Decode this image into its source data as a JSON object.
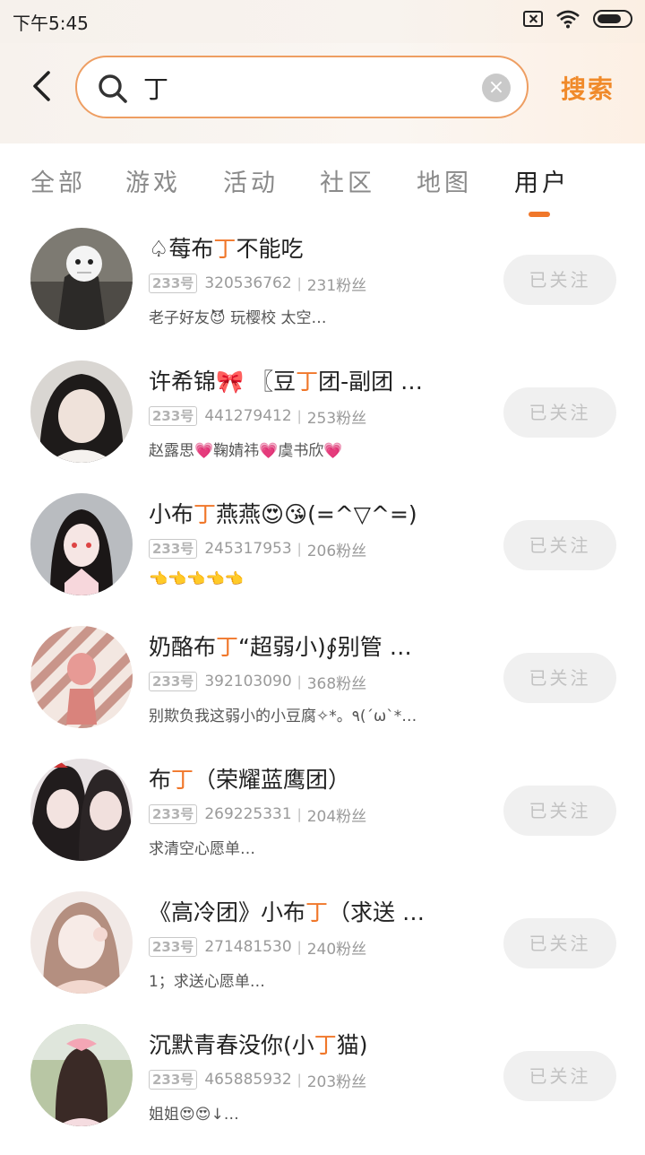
{
  "status_bar": {
    "time": "下午5:45"
  },
  "search": {
    "query": "丁",
    "clear_symbol": "×",
    "submit_label": "搜索"
  },
  "tabs": [
    {
      "label": "全部"
    },
    {
      "label": "游戏"
    },
    {
      "label": "活动"
    },
    {
      "label": "社区"
    },
    {
      "label": "地图"
    },
    {
      "label": "用户",
      "active": true
    }
  ],
  "accent_color": "#f0772a",
  "users": [
    {
      "name_before": "♤莓布",
      "name_hl": "丁",
      "name_after": "不能吃",
      "badge": "233号",
      "uid": "320536762",
      "fans": "231粉丝",
      "signature": "老子好友😈 玩樱校  太空…",
      "follow_label": "已关注"
    },
    {
      "name_before": "许希锦🎀 〖豆",
      "name_hl": "丁",
      "name_after": "团-副团 …",
      "badge": "233号",
      "uid": "441279412",
      "fans": "253粉丝",
      "signature": "赵露思💗鞠婧祎💗虞书欣💗",
      "follow_label": "已关注"
    },
    {
      "name_before": "小布",
      "name_hl": "丁",
      "name_after": "燕燕😍😘(=^▽^=)",
      "badge": "233号",
      "uid": "245317953",
      "fans": "206粉丝",
      "signature": "👈👈👈👈👈",
      "follow_label": "已关注"
    },
    {
      "name_before": "奶酪布",
      "name_hl": "丁",
      "name_after": "“超弱小)∮别管 …",
      "badge": "233号",
      "uid": "392103090",
      "fans": "368粉丝",
      "signature": "别欺负我这弱小的小豆腐✧*。٩(ˊωˋ*…",
      "follow_label": "已关注"
    },
    {
      "name_before": "布",
      "name_hl": "丁",
      "name_after": "（荣耀蓝鹰团）",
      "badge": "233号",
      "uid": "269225331",
      "fans": "204粉丝",
      "signature": "求清空心愿单…",
      "follow_label": "已关注"
    },
    {
      "name_before": "《高冷团》小布",
      "name_hl": "丁",
      "name_after": "（求送 …",
      "badge": "233号",
      "uid": "271481530",
      "fans": "240粉丝",
      "signature": "1；求送心愿单…",
      "follow_label": "已关注"
    },
    {
      "name_before": "沉默青春没你(小",
      "name_hl": "丁",
      "name_after": "猫)",
      "badge": "233号",
      "uid": "465885932",
      "fans": "203粉丝",
      "signature": "姐姐😍😍↓…",
      "follow_label": "已关注"
    }
  ]
}
